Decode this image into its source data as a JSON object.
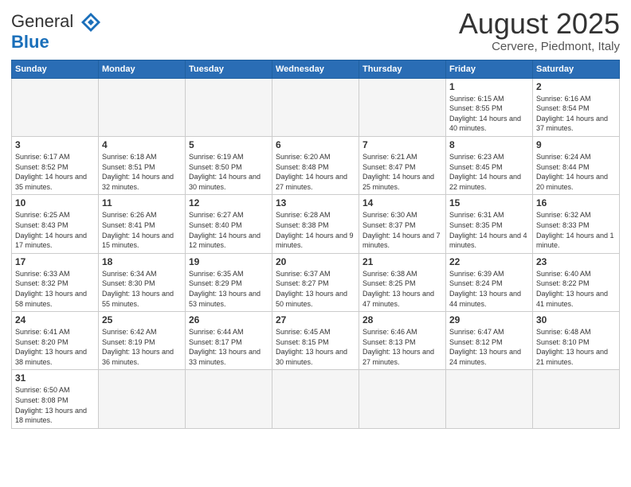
{
  "logo": {
    "text_general": "General",
    "text_blue": "Blue"
  },
  "title": "August 2025",
  "subtitle": "Cervere, Piedmont, Italy",
  "days_of_week": [
    "Sunday",
    "Monday",
    "Tuesday",
    "Wednesday",
    "Thursday",
    "Friday",
    "Saturday"
  ],
  "weeks": [
    [
      {
        "day": "",
        "info": ""
      },
      {
        "day": "",
        "info": ""
      },
      {
        "day": "",
        "info": ""
      },
      {
        "day": "",
        "info": ""
      },
      {
        "day": "",
        "info": ""
      },
      {
        "day": "1",
        "info": "Sunrise: 6:15 AM\nSunset: 8:55 PM\nDaylight: 14 hours and 40 minutes."
      },
      {
        "day": "2",
        "info": "Sunrise: 6:16 AM\nSunset: 8:54 PM\nDaylight: 14 hours and 37 minutes."
      }
    ],
    [
      {
        "day": "3",
        "info": "Sunrise: 6:17 AM\nSunset: 8:52 PM\nDaylight: 14 hours and 35 minutes."
      },
      {
        "day": "4",
        "info": "Sunrise: 6:18 AM\nSunset: 8:51 PM\nDaylight: 14 hours and 32 minutes."
      },
      {
        "day": "5",
        "info": "Sunrise: 6:19 AM\nSunset: 8:50 PM\nDaylight: 14 hours and 30 minutes."
      },
      {
        "day": "6",
        "info": "Sunrise: 6:20 AM\nSunset: 8:48 PM\nDaylight: 14 hours and 27 minutes."
      },
      {
        "day": "7",
        "info": "Sunrise: 6:21 AM\nSunset: 8:47 PM\nDaylight: 14 hours and 25 minutes."
      },
      {
        "day": "8",
        "info": "Sunrise: 6:23 AM\nSunset: 8:45 PM\nDaylight: 14 hours and 22 minutes."
      },
      {
        "day": "9",
        "info": "Sunrise: 6:24 AM\nSunset: 8:44 PM\nDaylight: 14 hours and 20 minutes."
      }
    ],
    [
      {
        "day": "10",
        "info": "Sunrise: 6:25 AM\nSunset: 8:43 PM\nDaylight: 14 hours and 17 minutes."
      },
      {
        "day": "11",
        "info": "Sunrise: 6:26 AM\nSunset: 8:41 PM\nDaylight: 14 hours and 15 minutes."
      },
      {
        "day": "12",
        "info": "Sunrise: 6:27 AM\nSunset: 8:40 PM\nDaylight: 14 hours and 12 minutes."
      },
      {
        "day": "13",
        "info": "Sunrise: 6:28 AM\nSunset: 8:38 PM\nDaylight: 14 hours and 9 minutes."
      },
      {
        "day": "14",
        "info": "Sunrise: 6:30 AM\nSunset: 8:37 PM\nDaylight: 14 hours and 7 minutes."
      },
      {
        "day": "15",
        "info": "Sunrise: 6:31 AM\nSunset: 8:35 PM\nDaylight: 14 hours and 4 minutes."
      },
      {
        "day": "16",
        "info": "Sunrise: 6:32 AM\nSunset: 8:33 PM\nDaylight: 14 hours and 1 minute."
      }
    ],
    [
      {
        "day": "17",
        "info": "Sunrise: 6:33 AM\nSunset: 8:32 PM\nDaylight: 13 hours and 58 minutes."
      },
      {
        "day": "18",
        "info": "Sunrise: 6:34 AM\nSunset: 8:30 PM\nDaylight: 13 hours and 55 minutes."
      },
      {
        "day": "19",
        "info": "Sunrise: 6:35 AM\nSunset: 8:29 PM\nDaylight: 13 hours and 53 minutes."
      },
      {
        "day": "20",
        "info": "Sunrise: 6:37 AM\nSunset: 8:27 PM\nDaylight: 13 hours and 50 minutes."
      },
      {
        "day": "21",
        "info": "Sunrise: 6:38 AM\nSunset: 8:25 PM\nDaylight: 13 hours and 47 minutes."
      },
      {
        "day": "22",
        "info": "Sunrise: 6:39 AM\nSunset: 8:24 PM\nDaylight: 13 hours and 44 minutes."
      },
      {
        "day": "23",
        "info": "Sunrise: 6:40 AM\nSunset: 8:22 PM\nDaylight: 13 hours and 41 minutes."
      }
    ],
    [
      {
        "day": "24",
        "info": "Sunrise: 6:41 AM\nSunset: 8:20 PM\nDaylight: 13 hours and 38 minutes."
      },
      {
        "day": "25",
        "info": "Sunrise: 6:42 AM\nSunset: 8:19 PM\nDaylight: 13 hours and 36 minutes."
      },
      {
        "day": "26",
        "info": "Sunrise: 6:44 AM\nSunset: 8:17 PM\nDaylight: 13 hours and 33 minutes."
      },
      {
        "day": "27",
        "info": "Sunrise: 6:45 AM\nSunset: 8:15 PM\nDaylight: 13 hours and 30 minutes."
      },
      {
        "day": "28",
        "info": "Sunrise: 6:46 AM\nSunset: 8:13 PM\nDaylight: 13 hours and 27 minutes."
      },
      {
        "day": "29",
        "info": "Sunrise: 6:47 AM\nSunset: 8:12 PM\nDaylight: 13 hours and 24 minutes."
      },
      {
        "day": "30",
        "info": "Sunrise: 6:48 AM\nSunset: 8:10 PM\nDaylight: 13 hours and 21 minutes."
      }
    ],
    [
      {
        "day": "31",
        "info": "Sunrise: 6:50 AM\nSunset: 8:08 PM\nDaylight: 13 hours and 18 minutes."
      },
      {
        "day": "",
        "info": ""
      },
      {
        "day": "",
        "info": ""
      },
      {
        "day": "",
        "info": ""
      },
      {
        "day": "",
        "info": ""
      },
      {
        "day": "",
        "info": ""
      },
      {
        "day": "",
        "info": ""
      }
    ]
  ]
}
